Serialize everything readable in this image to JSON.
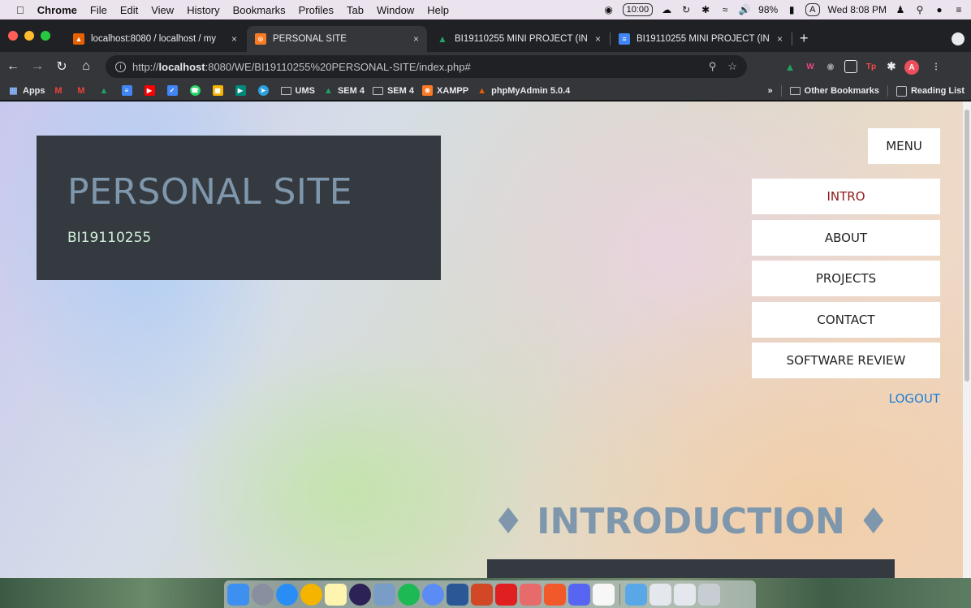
{
  "menubar": {
    "app": "Chrome",
    "items": [
      "File",
      "Edit",
      "View",
      "History",
      "Bookmarks",
      "Profiles",
      "Tab",
      "Window",
      "Help"
    ],
    "timer": "10:00",
    "battery": "98%",
    "input_source": "A",
    "clock": "Wed 8:08 PM"
  },
  "tabs": [
    {
      "title": "localhost:8080 / localhost / my",
      "close": "×",
      "favicon_color": "#e66000"
    },
    {
      "title": "PERSONAL SITE",
      "close": "×",
      "favicon_color": "#fb7a24"
    },
    {
      "title": "BI19110255 MINI PROJECT (IN",
      "close": "×",
      "favicon_color": "#1fa463"
    },
    {
      "title": "BI19110255 MINI PROJECT (IN",
      "close": "×",
      "favicon_color": "#4285f4"
    }
  ],
  "new_tab": "+",
  "address": {
    "prefix": "http://",
    "host": "localhost",
    "rest": ":8080/WE/BI19110255%20PERSONAL-SITE/index.php#"
  },
  "bookmarks": {
    "apps": "Apps",
    "ums": "UMS",
    "sem4_a": "SEM 4",
    "sem4_b": "SEM 4",
    "xampp": "XAMPP",
    "phpmyadmin": "phpMyAdmin 5.0.4",
    "more": "»",
    "other": "Other Bookmarks",
    "reading": "Reading List"
  },
  "page": {
    "title": "PERSONAL SITE",
    "subtitle": "BI19110255",
    "menu_label": "MENU",
    "nav": [
      "INTRO",
      "ABOUT",
      "PROJECTS",
      "CONTACT",
      "SOFTWARE REVIEW"
    ],
    "logout": "LOGOUT",
    "section_heading": "♦ INTRODUCTION ♦"
  },
  "colors": {
    "accent_active": "#8b1a1a",
    "link": "#1e7fd6",
    "panel": "#353a40"
  }
}
